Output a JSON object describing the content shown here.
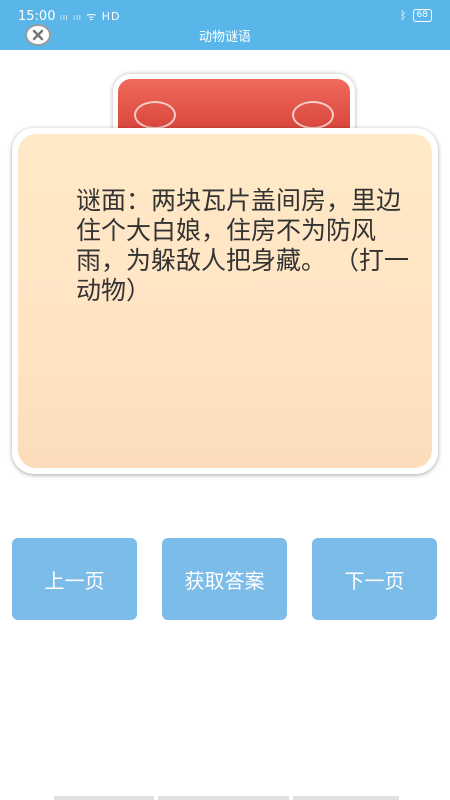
{
  "status_bar": {
    "time": "15:00",
    "signal": "ᵢₗₗ ᵢₗₗ",
    "hd": "HD",
    "battery": "68"
  },
  "header": {
    "title": "动物谜语"
  },
  "riddle": {
    "text": "谜面：两块瓦片盖间房，里边住个大白娘，住房不为防风雨，为躲敌人把身藏。 （打一动物）"
  },
  "buttons": {
    "prev": "上一页",
    "answer": "获取答案",
    "next": "下一页"
  }
}
